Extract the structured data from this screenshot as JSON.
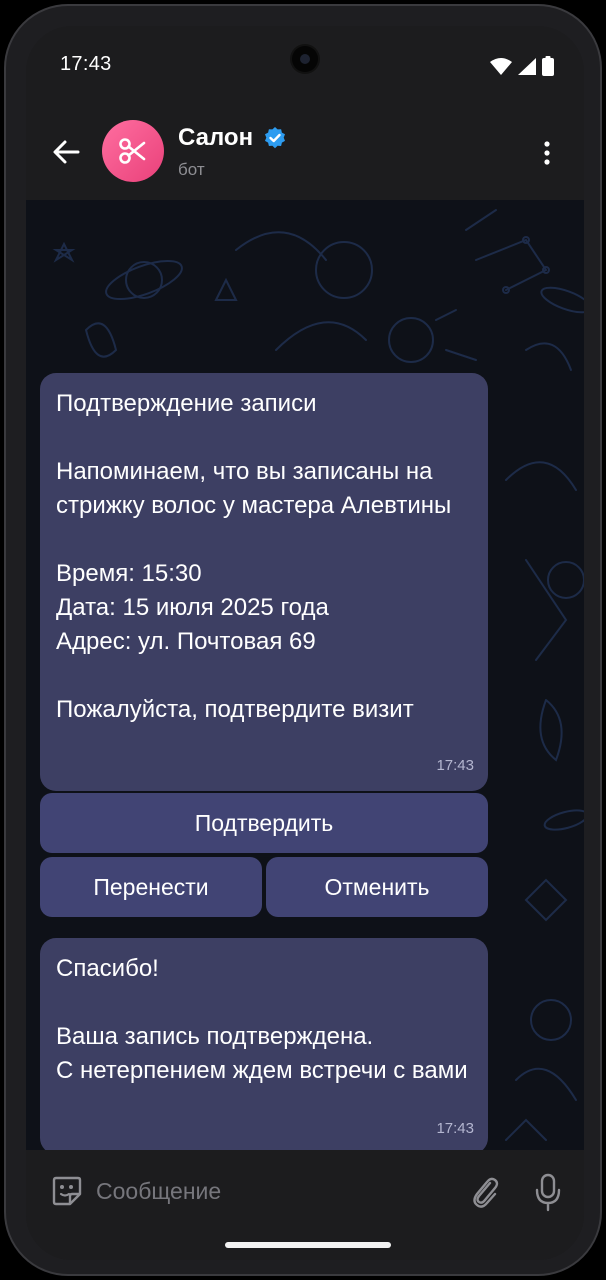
{
  "status": {
    "time": "17:43"
  },
  "chat": {
    "title": "Салон",
    "subtitle": "бот"
  },
  "messages": [
    {
      "paragraphs": [
        "Подтверждение записи",
        "Напоминаем, что вы записаны на стрижку волос у мастера Алевтины",
        "Время: 15:30\nДата: 15 июля 2025 года\nАдрес: ул. Почтовая 69",
        "Пожалуйста, подтвердите визит"
      ],
      "time": "17:43"
    },
    {
      "paragraphs": [
        "Спасибо!",
        "Ваша запись подтверждена.\nС нетерпением ждем встречи с вами"
      ],
      "time": "17:43"
    }
  ],
  "keyboard": {
    "confirm": "Подтвердить",
    "reschedule": "Перенести",
    "cancel": "Отменить"
  },
  "composer": {
    "placeholder": "Сообщение"
  },
  "colors": {
    "bubble": "#3d3f63",
    "button": "#414474",
    "avatar": "#ef4f88",
    "verified": "#2d9cf0"
  }
}
